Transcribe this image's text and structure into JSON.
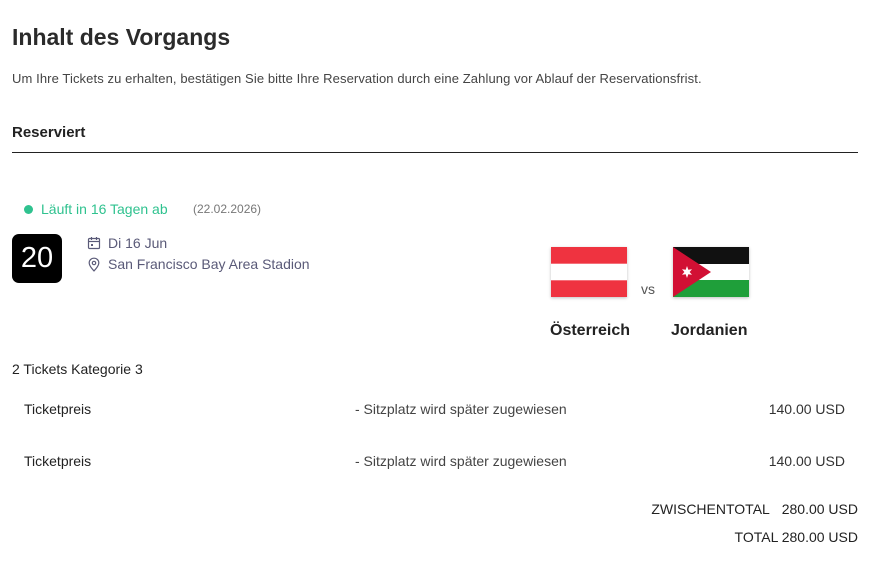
{
  "page": {
    "title": "Inhalt des Vorgangs",
    "intro": "Um Ihre Tickets zu erhalten, bestätigen Sie bitte Ihre Reservation durch eine Zahlung vor Ablauf der Reservationsfrist."
  },
  "reservation": {
    "section_label": "Reserviert",
    "status_text": "Läuft in 16 Tagen ab",
    "status_date": "(22.02.2026)",
    "status_color": "#2fc28f",
    "day_number": "20",
    "date_text": "Di 16 Jun",
    "venue_text": "San Francisco Bay Area Stadion",
    "icons": {
      "date": "calendar-icon",
      "venue": "location-pin-icon"
    }
  },
  "match": {
    "vs": "vs",
    "team_a": {
      "name": "Österreich",
      "flag": "austria-flag"
    },
    "team_b": {
      "name": "Jordanien",
      "flag": "jordan-flag"
    }
  },
  "tickets": {
    "heading": "2 Tickets Kategorie 3",
    "rows": [
      {
        "label": "Ticketpreis",
        "note": "- Sitzplatz wird später zugewiesen",
        "price": "140.00 USD"
      },
      {
        "label": "Ticketpreis",
        "note": "- Sitzplatz wird später zugewiesen",
        "price": "140.00 USD"
      }
    ]
  },
  "totals": {
    "subtotal_label": "ZWISCHENTOTAL",
    "subtotal_value": "280.00 USD",
    "total_text": "TOTAL 280.00 USD"
  }
}
